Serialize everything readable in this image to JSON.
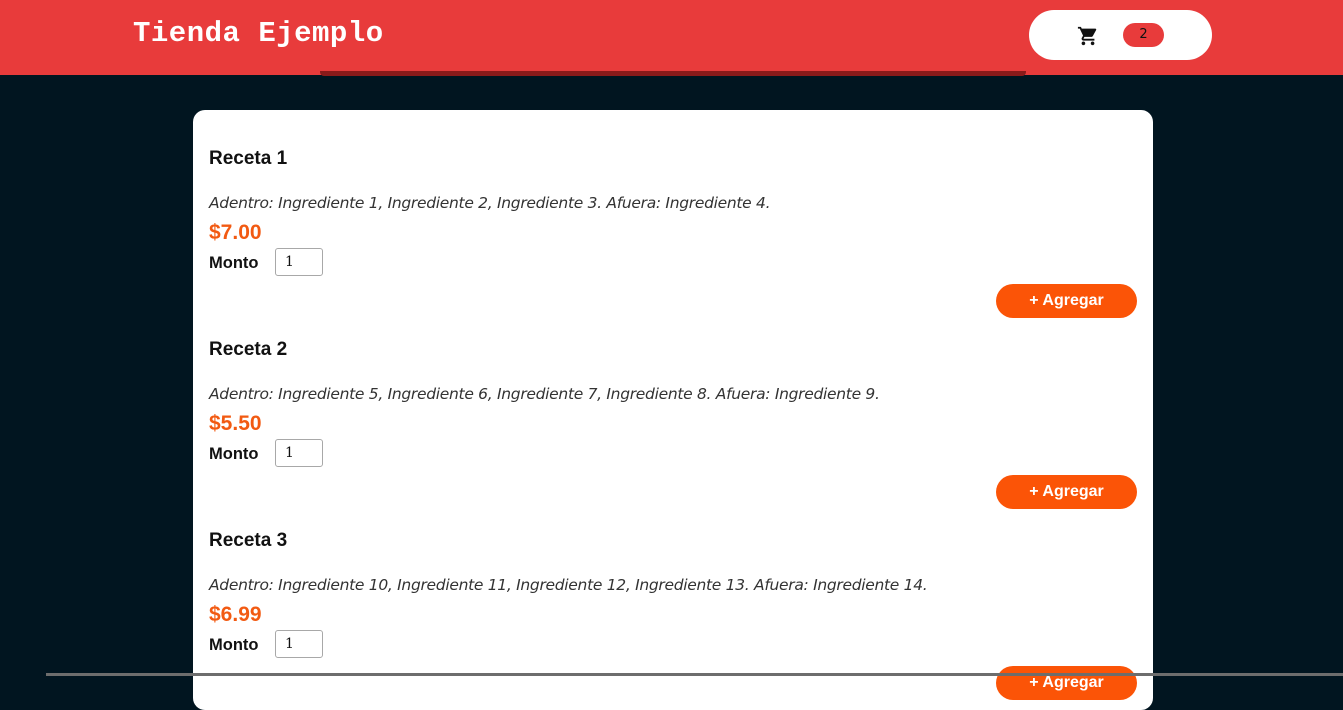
{
  "header": {
    "brand": "Tienda Ejemplo",
    "cart_icon": "shopping-cart-icon",
    "cart_count": "2",
    "accent_color": "#e83b3b"
  },
  "products": [
    {
      "name": "Receta 1",
      "description": "Adentro: Ingrediente 1, Ingrediente 2, Ingrediente 3. Afuera: Ingrediente 4.",
      "price": "$7.00",
      "qty_label": "Monto",
      "qty_value": "1",
      "add_label": "+ Agregar"
    },
    {
      "name": "Receta 2",
      "description": "Adentro: Ingrediente 5, Ingrediente 6, Ingrediente 7, Ingrediente 8. Afuera: Ingrediente 9.",
      "price": "$5.50",
      "qty_label": "Monto",
      "qty_value": "1",
      "add_label": "+ Agregar"
    },
    {
      "name": "Receta 3",
      "description": "Adentro: Ingrediente 10, Ingrediente 11, Ingrediente 12, Ingrediente 13. Afuera: Ingrediente 14.",
      "price": "$6.99",
      "qty_label": "Monto",
      "qty_value": "1",
      "add_label": "+ Agregar"
    }
  ],
  "colors": {
    "background": "#011520",
    "price": "#f25a12",
    "button": "#fb5407"
  }
}
